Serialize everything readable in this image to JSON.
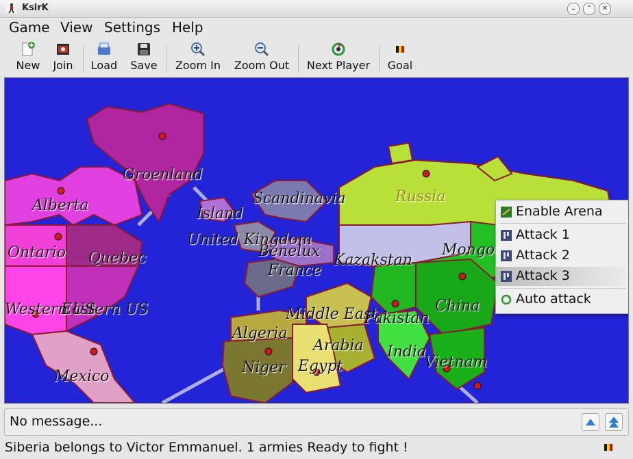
{
  "window": {
    "title": "KsirK"
  },
  "menubar": {
    "items": [
      "Game",
      "View",
      "Settings",
      "Help"
    ]
  },
  "toolbar": {
    "new": "New",
    "join": "Join",
    "load": "Load",
    "save": "Save",
    "zoom_in": "Zoom In",
    "zoom_out": "Zoom Out",
    "next_player": "Next Player",
    "goal": "Goal"
  },
  "map": {
    "countries": [
      "Groenland",
      "Alberta",
      "Ontario",
      "Quebec",
      "Western US",
      "Eastern US",
      "Mexico",
      "Island",
      "Scandinavia",
      "United Kingdom",
      "Benelux",
      "Russia",
      "France",
      "Kazakstan",
      "Mongolia",
      "China",
      "Middle East",
      "Pakistan",
      "Algeria",
      "Niger",
      "Egypt",
      "Arabia",
      "India",
      "Vietnam"
    ]
  },
  "context_menu": {
    "items": [
      {
        "label": "Enable Arena",
        "icon": "arena-icon"
      },
      {
        "label": "Attack 1",
        "icon": "attack-icon"
      },
      {
        "label": "Attack 2",
        "icon": "attack-icon"
      },
      {
        "label": "Attack 3",
        "icon": "attack-icon",
        "highlighted": true
      },
      {
        "label": "Auto attack",
        "icon": "auto-attack-icon"
      }
    ]
  },
  "message_bar": {
    "text": "No message..."
  },
  "status_bar": {
    "text": "Siberia belongs to Victor Emmanuel. 1 armies Ready to fight !"
  },
  "colors": {
    "ocean": "#2323d8",
    "window_bg": "#e6e6e6",
    "menu_highlight": "#bdbdbd"
  }
}
